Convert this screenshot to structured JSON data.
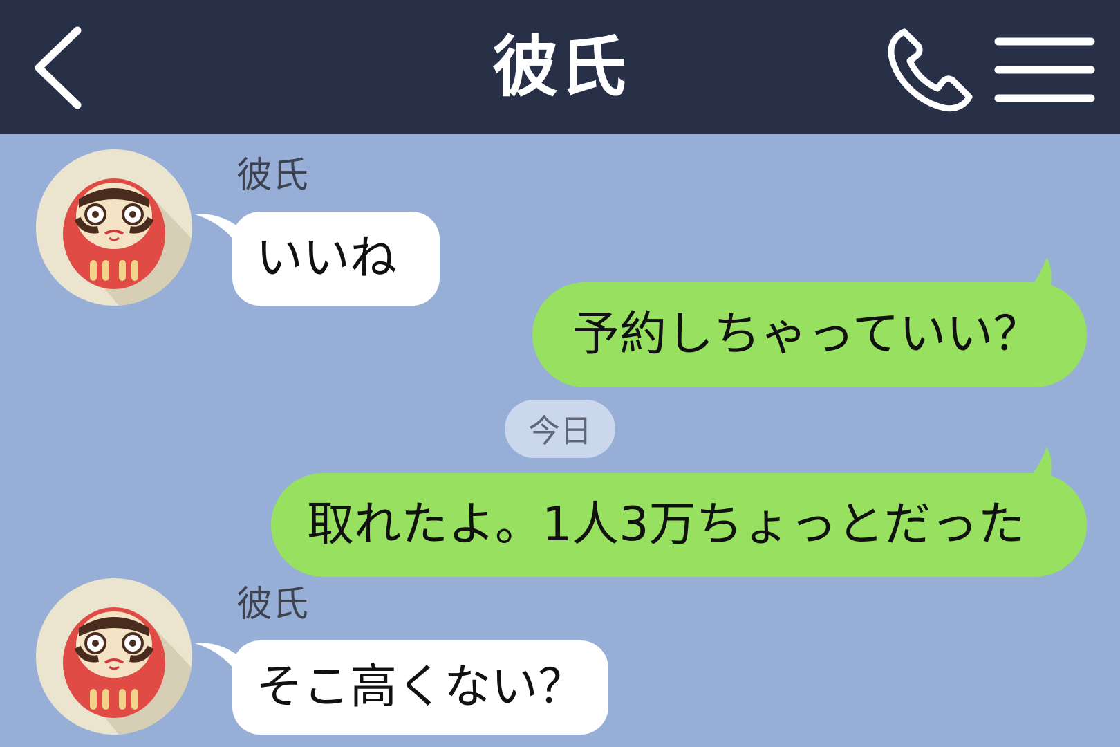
{
  "header": {
    "title": "彼氏",
    "back_icon": "chevron-left-icon",
    "call_icon": "phone-icon",
    "menu_icon": "hamburger-menu-icon"
  },
  "colors": {
    "header_bg": "#283048",
    "chat_bg": "#97afd7",
    "incoming_bubble": "#ffffff",
    "outgoing_bubble": "#98e060",
    "date_chip": "#cbd7ec"
  },
  "messages": [
    {
      "direction": "incoming",
      "sender": "彼氏",
      "text": "いいね",
      "avatar": "daruma-avatar"
    },
    {
      "direction": "outgoing",
      "text": "予約しちゃっていい？"
    },
    {
      "direction": "outgoing",
      "text": "取れたよ。1人3万ちょっとだった"
    },
    {
      "direction": "incoming",
      "sender": "彼氏",
      "text": "そこ高くない？",
      "avatar": "daruma-avatar"
    }
  ],
  "date_separator": "今日"
}
